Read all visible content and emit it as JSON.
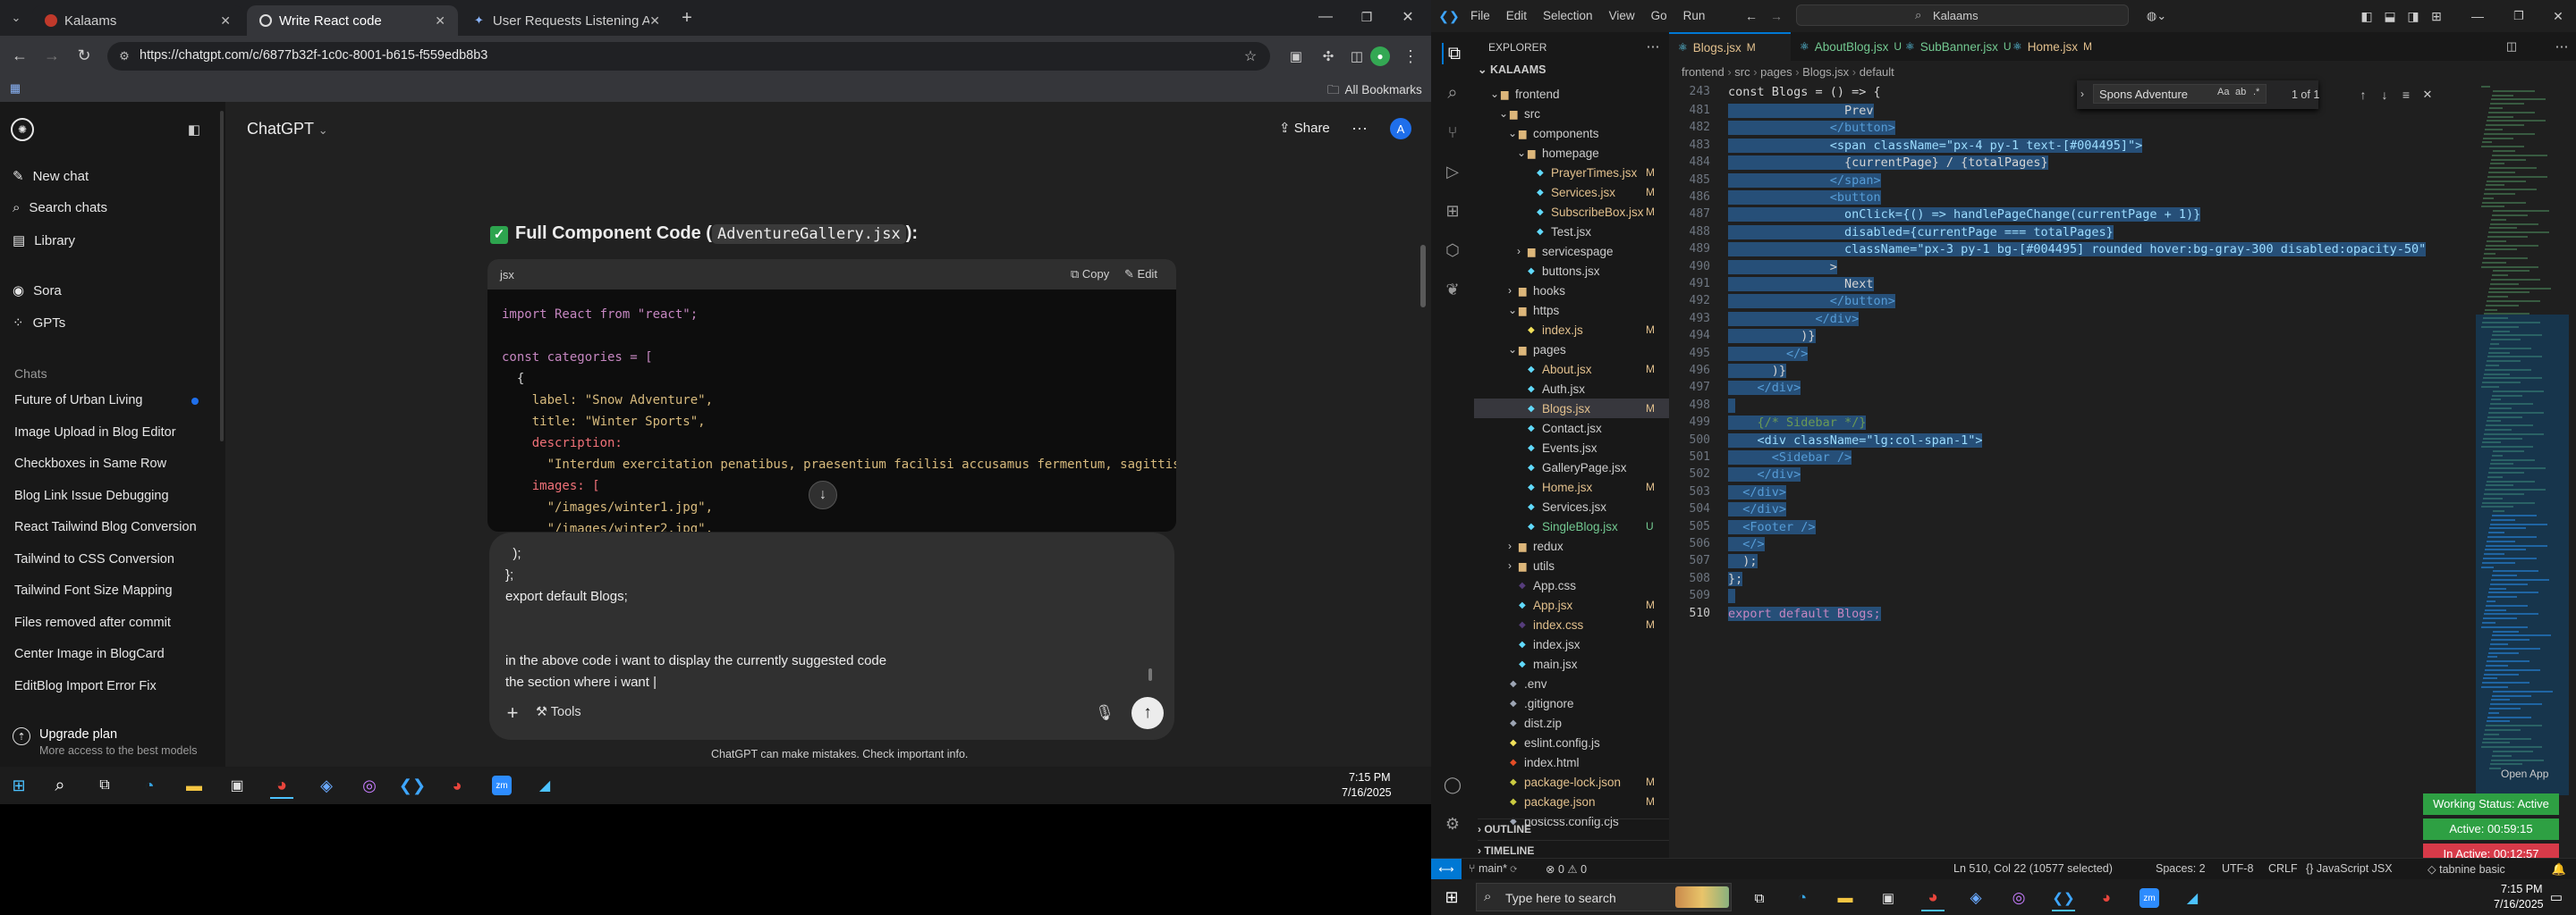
{
  "chrome": {
    "tabs": [
      {
        "label": "Kalaams"
      },
      {
        "label": "Write React code"
      },
      {
        "label": "User Requests Listening Assis"
      }
    ],
    "url": "https://chatgpt.com/c/6877b32f-1c0c-8001-b615-f559edb8b3",
    "bookmarks_label": "All Bookmarks"
  },
  "chatgpt": {
    "title": "ChatGPT",
    "share_label": "Share",
    "avatar_letter": "A",
    "sidebar": {
      "new_chat": "New chat",
      "search_chats": "Search chats",
      "library": "Library",
      "sora": "Sora",
      "gpts": "GPTs",
      "chats_heading": "Chats",
      "chats": [
        "Future of Urban Living",
        "Image Upload in Blog Editor",
        "Checkboxes in Same Row",
        "Blog Link Issue Debugging",
        "React Tailwind Blog Conversion",
        "Tailwind to CSS Conversion",
        "Tailwind Font Size Mapping",
        "Files removed after commit",
        "Center Image in BlogCard",
        "EditBlog Import Error Fix"
      ],
      "upgrade_title": "Upgrade plan",
      "upgrade_sub": "More access to the best models"
    },
    "heading_prefix": "Full Component Code (",
    "heading_code": "AdventureGallery.jsx",
    "heading_suffix": "):",
    "code_lang": "jsx",
    "copy_label": "Copy",
    "edit_label": "Edit",
    "code_lines": [
      "import React from \"react\";",
      "",
      "const categories = [",
      "  {",
      "    label: \"Snow Adventure\",",
      "    title: \"Winter Sports\",",
      "    description:",
      "      \"Interdum exercitation penatibus, praesentium facilisi accusamus fermentum, sagittis.\",",
      "    images: [",
      "      \"/images/winter1.jpg\",",
      "      \"/images/winter2.jpg\","
    ],
    "composer_lines": [
      "  );",
      "};",
      "export default Blogs;",
      "",
      "",
      "in the above code i want to display the currently suggested code",
      "the section where i want |"
    ],
    "tools_label": "Tools",
    "disclaimer": "ChatGPT can make mistakes. Check important info."
  },
  "taskbar_left": {
    "time": "7:15 PM",
    "date": "7/16/2025"
  },
  "vscode": {
    "menu": [
      "File",
      "Edit",
      "Selection",
      "View",
      "Go",
      "Run"
    ],
    "search_text": "Kalaams",
    "explorer_title": "EXPLORER",
    "root": "KALAAMS",
    "tree": [
      {
        "label": "frontend",
        "depth": 1,
        "type": "folder-open",
        "mark": ""
      },
      {
        "label": "src",
        "depth": 2,
        "type": "folder-open",
        "mark": ""
      },
      {
        "label": "components",
        "depth": 3,
        "type": "folder-open",
        "mark": ""
      },
      {
        "label": "homepage",
        "depth": 4,
        "type": "folder-open",
        "mark": ""
      },
      {
        "label": "PrayerTimes.jsx",
        "depth": 5,
        "type": "file",
        "mark": "M"
      },
      {
        "label": "Services.jsx",
        "depth": 5,
        "type": "file",
        "mark": "M"
      },
      {
        "label": "SubscribeBox.jsx",
        "depth": 5,
        "type": "file",
        "mark": "M"
      },
      {
        "label": "Test.jsx",
        "depth": 5,
        "type": "file",
        "mark": ""
      },
      {
        "label": "servicespage",
        "depth": 4,
        "type": "folder",
        "mark": ""
      },
      {
        "label": "buttons.jsx",
        "depth": 4,
        "type": "file",
        "mark": ""
      },
      {
        "label": "hooks",
        "depth": 3,
        "type": "folder",
        "mark": ""
      },
      {
        "label": "https",
        "depth": 3,
        "type": "folder-open",
        "mark": ""
      },
      {
        "label": "index.js",
        "depth": 4,
        "type": "file",
        "mark": "M"
      },
      {
        "label": "pages",
        "depth": 3,
        "type": "folder-open",
        "mark": ""
      },
      {
        "label": "About.jsx",
        "depth": 4,
        "type": "file",
        "mark": "M"
      },
      {
        "label": "Auth.jsx",
        "depth": 4,
        "type": "file",
        "mark": ""
      },
      {
        "label": "Blogs.jsx",
        "depth": 4,
        "type": "file",
        "mark": "M",
        "active": true
      },
      {
        "label": "Contact.jsx",
        "depth": 4,
        "type": "file",
        "mark": ""
      },
      {
        "label": "Events.jsx",
        "depth": 4,
        "type": "file",
        "mark": ""
      },
      {
        "label": "GalleryPage.jsx",
        "depth": 4,
        "type": "file",
        "mark": ""
      },
      {
        "label": "Home.jsx",
        "depth": 4,
        "type": "file",
        "mark": "M"
      },
      {
        "label": "Services.jsx",
        "depth": 4,
        "type": "file",
        "mark": ""
      },
      {
        "label": "SingleBlog.jsx",
        "depth": 4,
        "type": "file",
        "mark": "U"
      },
      {
        "label": "redux",
        "depth": 3,
        "type": "folder",
        "mark": ""
      },
      {
        "label": "utils",
        "depth": 3,
        "type": "folder",
        "mark": ""
      },
      {
        "label": "App.css",
        "depth": 3,
        "type": "file",
        "mark": ""
      },
      {
        "label": "App.jsx",
        "depth": 3,
        "type": "file",
        "mark": "M"
      },
      {
        "label": "index.css",
        "depth": 3,
        "type": "file",
        "mark": "M"
      },
      {
        "label": "index.jsx",
        "depth": 3,
        "type": "file",
        "mark": ""
      },
      {
        "label": "main.jsx",
        "depth": 3,
        "type": "file",
        "mark": ""
      },
      {
        "label": ".env",
        "depth": 2,
        "type": "file",
        "mark": ""
      },
      {
        "label": ".gitignore",
        "depth": 2,
        "type": "file",
        "mark": ""
      },
      {
        "label": "dist.zip",
        "depth": 2,
        "type": "file",
        "mark": ""
      },
      {
        "label": "eslint.config.js",
        "depth": 2,
        "type": "file",
        "mark": ""
      },
      {
        "label": "index.html",
        "depth": 2,
        "type": "file",
        "mark": ""
      },
      {
        "label": "package-lock.json",
        "depth": 2,
        "type": "file",
        "mark": "M"
      },
      {
        "label": "package.json",
        "depth": 2,
        "type": "file",
        "mark": "M"
      },
      {
        "label": "postcss.config.cjs",
        "depth": 2,
        "type": "file",
        "mark": ""
      }
    ],
    "outline": "OUTLINE",
    "timeline": "TIMELINE",
    "tabs": [
      {
        "label": "Blogs.jsx",
        "mark": "M"
      },
      {
        "label": "AboutBlog.jsx",
        "mark": "U"
      },
      {
        "label": "SubBanner.jsx",
        "mark": "U"
      },
      {
        "label": "Home.jsx",
        "mark": "M"
      }
    ],
    "breadcrumb": [
      "frontend",
      "src",
      "pages",
      "Blogs.jsx",
      "default"
    ],
    "sticky_line": {
      "num": "243",
      "text": "const Blogs = () => {"
    },
    "find_text": "Spons Adventure",
    "find_count": "1 of 1",
    "lines": [
      {
        "n": "481",
        "t": "                Prev"
      },
      {
        "n": "482",
        "t": "              </button>"
      },
      {
        "n": "483",
        "t": "              <span className=\"px-4 py-1 text-[#004495]\">"
      },
      {
        "n": "484",
        "t": "                {currentPage} / {totalPages}"
      },
      {
        "n": "485",
        "t": "              </span>"
      },
      {
        "n": "486",
        "t": "              <button"
      },
      {
        "n": "487",
        "t": "                onClick={() => handlePageChange(currentPage + 1)}"
      },
      {
        "n": "488",
        "t": "                disabled={currentPage === totalPages}"
      },
      {
        "n": "489",
        "t": "                className=\"px-3 py-1 bg-[#004495] rounded hover:bg-gray-300 disabled:opacity-50\""
      },
      {
        "n": "490",
        "t": "              >"
      },
      {
        "n": "491",
        "t": "                Next"
      },
      {
        "n": "492",
        "t": "              </button>"
      },
      {
        "n": "493",
        "t": "            </div>"
      },
      {
        "n": "494",
        "t": "          )}"
      },
      {
        "n": "495",
        "t": "        </>"
      },
      {
        "n": "496",
        "t": "      )}"
      },
      {
        "n": "497",
        "t": "    </div>"
      },
      {
        "n": "498",
        "t": ""
      },
      {
        "n": "499",
        "t": "    {/* Sidebar */}"
      },
      {
        "n": "500",
        "t": "    <div className=\"lg:col-span-1\">"
      },
      {
        "n": "501",
        "t": "      <Sidebar />"
      },
      {
        "n": "502",
        "t": "    </div>"
      },
      {
        "n": "503",
        "t": "  </div>"
      },
      {
        "n": "504",
        "t": "  </div>"
      },
      {
        "n": "505",
        "t": "  <Footer />"
      },
      {
        "n": "506",
        "t": "  </>"
      },
      {
        "n": "507",
        "t": "  );"
      },
      {
        "n": "508",
        "t": "};"
      },
      {
        "n": "509",
        "t": ""
      },
      {
        "n": "510",
        "t": "export default Blogs;"
      }
    ],
    "open_app": "Open App",
    "working_status": "Working Status: Active",
    "active_time": "Active: 00:59:15",
    "inactive_time": "In Active: 00:12:57",
    "status": {
      "branch": "main*",
      "problems": "0 ⚠ 0",
      "position": "Ln 510, Col 22 (10577 selected)",
      "spaces": "Spaces: 2",
      "encoding": "UTF-8",
      "eol": "CRLF",
      "language": "JavaScript JSX",
      "extra": "tabnine basic"
    }
  },
  "taskbar_right": {
    "search_placeholder": "Type here to search",
    "time": "7:15 PM",
    "date": "7/16/2025"
  },
  "colors": {
    "accent_blue": "#0078d4",
    "vs_selection": "#264f78",
    "working_green": "#2ea043",
    "inactive_red": "#d73a49",
    "check_green": "#2da44e"
  }
}
